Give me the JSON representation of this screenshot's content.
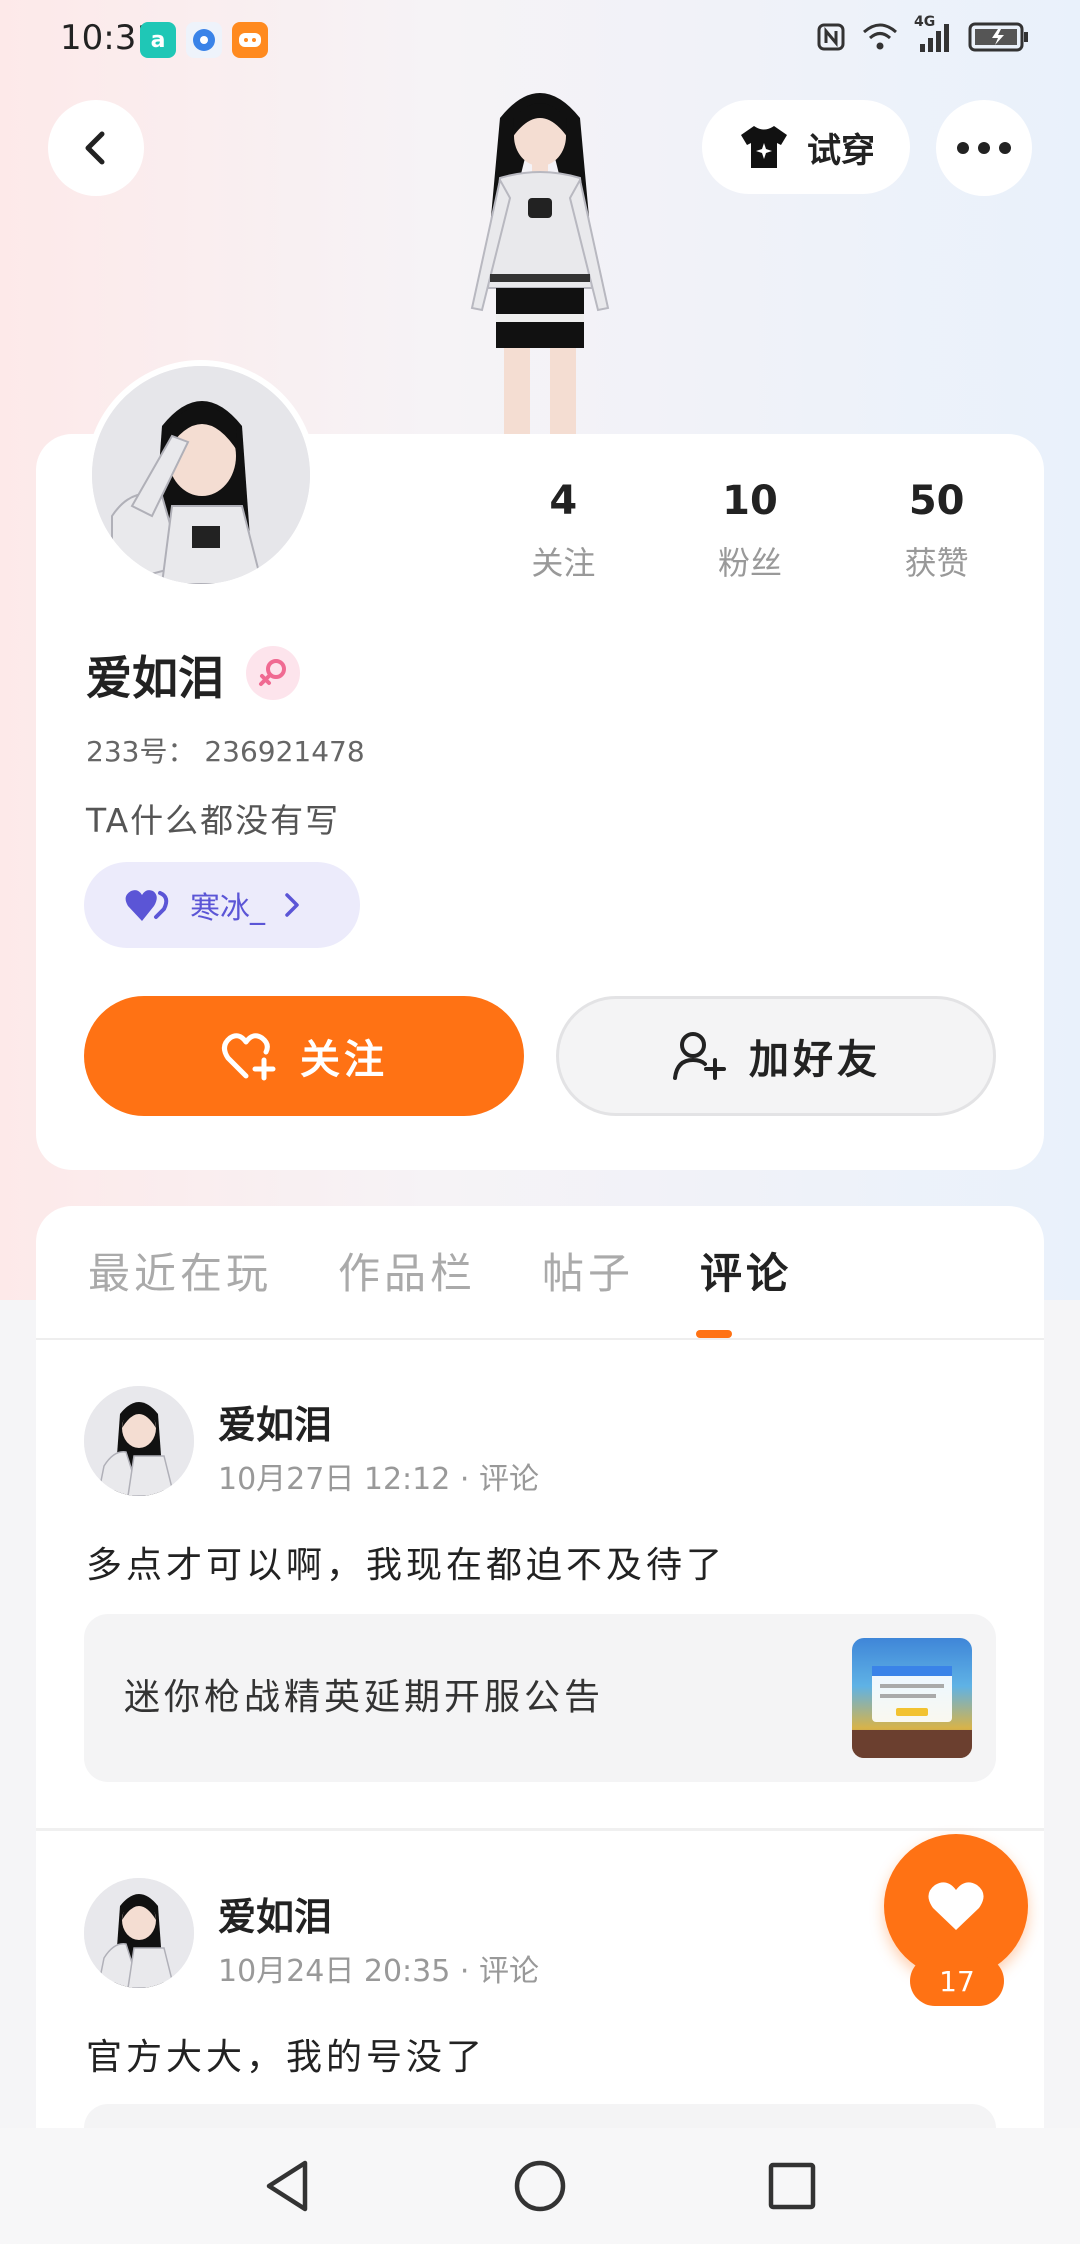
{
  "status_bar": {
    "time": "10:31",
    "network": "4G"
  },
  "header": {
    "tryon_label": "试穿"
  },
  "profile": {
    "name": "爱如泪",
    "id_label": "233号： 236921478",
    "bio": "TA什么都没有写",
    "couple_name": "寒冰_",
    "stats": [
      {
        "value": "4",
        "label": "关注"
      },
      {
        "value": "10",
        "label": "粉丝"
      },
      {
        "value": "50",
        "label": "获赞"
      }
    ],
    "follow_label": "关注",
    "add_friend_label": "加好友"
  },
  "tabs": [
    {
      "label": "最近在玩",
      "active": false
    },
    {
      "label": "作品栏",
      "active": false
    },
    {
      "label": "帖子",
      "active": false
    },
    {
      "label": "评论",
      "active": true
    }
  ],
  "posts": [
    {
      "author": "爱如泪",
      "meta": "10月27日 12:12 · 评论",
      "text": "多点才可以啊，我现在都迫不及待了",
      "linked_title": "迷你枪战精英延期开服公告"
    },
    {
      "author": "爱如泪",
      "meta": "10月24日 20:35 · 评论",
      "text": "官方大大，我的号没了"
    }
  ],
  "like": {
    "count": "17"
  },
  "colors": {
    "accent": "#ff7214",
    "couple_tag": "#5b55d6"
  }
}
